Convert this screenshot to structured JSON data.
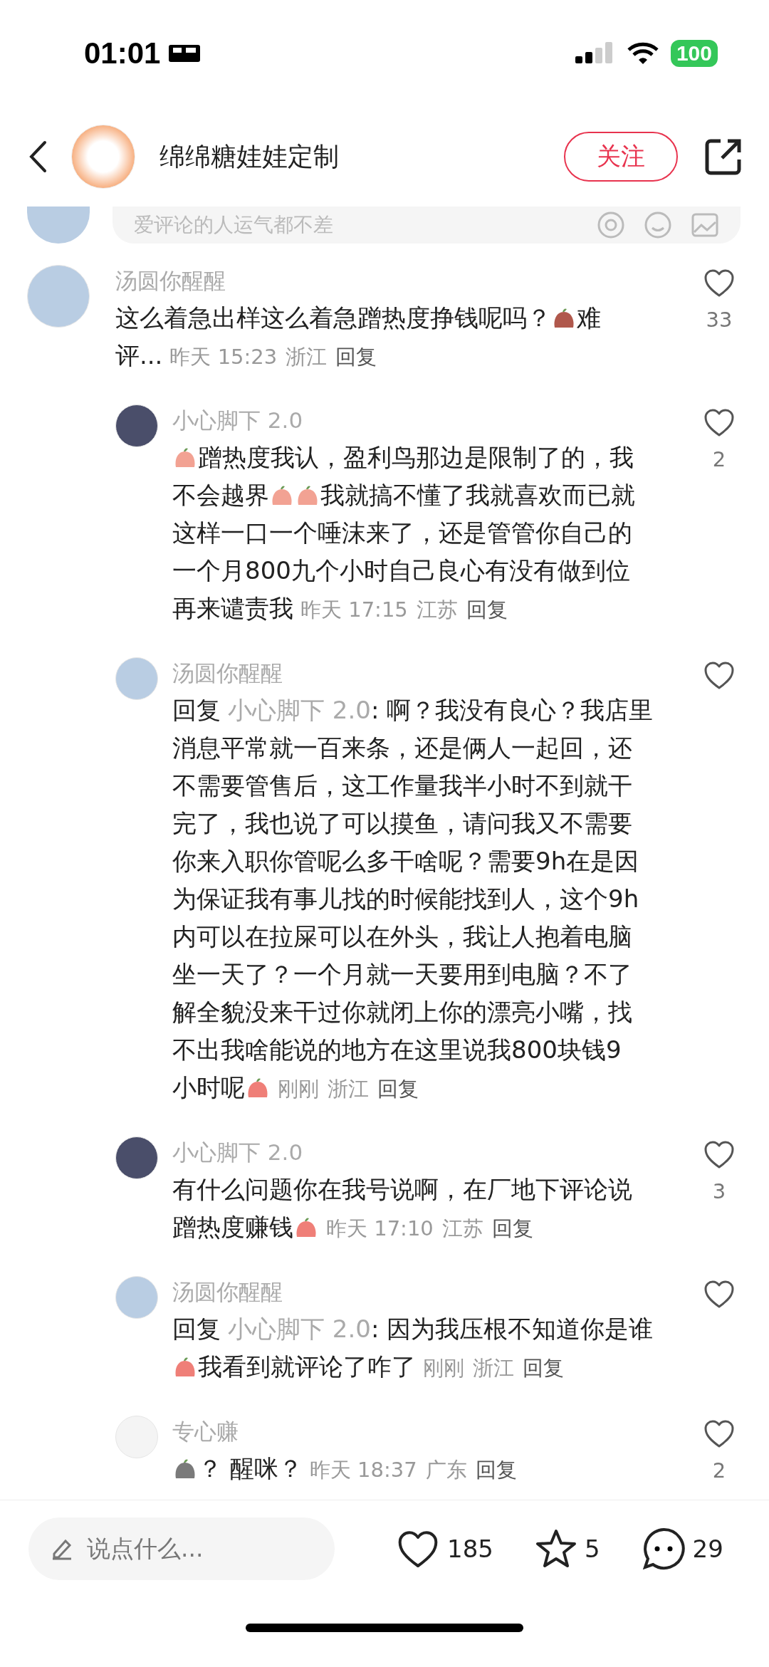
{
  "status_bar": {
    "time": "01:01",
    "battery": "100"
  },
  "header": {
    "title": "绵绵糖娃娃定制",
    "follow_button": "关注"
  },
  "comment_input": {
    "placeholder": "爱评论的人运气都不差"
  },
  "comments": [
    {
      "name": "汤圆你醒醒",
      "color": "#b9cde3",
      "lines": [
        [
          {
            "kind": "text",
            "text": "这么着急出样这么着急蹭热度挣钱呢吗？"
          },
          {
            "kind": "sticker",
            "color": "#b0584c"
          },
          {
            "kind": "text",
            "text": "难"
          }
        ],
        [
          {
            "kind": "text",
            "text": "评..."
          }
        ]
      ],
      "time": "昨天 15:23",
      "location": "浙江",
      "reply_label": "回复",
      "likes": "33",
      "replies": [
        {
          "name": "小心脚下 2.0",
          "color": "#4a4e6a",
          "lines": [
            [
              {
                "kind": "sticker",
                "color": "#f2a293"
              },
              {
                "kind": "text",
                "text": "蹭热度我认，盈利鸟那边是限制了的，我"
              }
            ],
            [
              {
                "kind": "text",
                "text": "不会越界"
              },
              {
                "kind": "sticker",
                "color": "#f2a293"
              },
              {
                "kind": "sticker",
                "color": "#f2a293"
              },
              {
                "kind": "text",
                "text": "我就搞不懂了我就喜欢而已就"
              }
            ],
            [
              {
                "kind": "text",
                "text": "这样一口一个唾沫来了，还是管管你自己的"
              }
            ],
            [
              {
                "kind": "text",
                "text": "一个月800九个小时自己良心有没有做到位"
              }
            ],
            [
              {
                "kind": "text",
                "text": "再来谴责我"
              }
            ]
          ],
          "time": "昨天 17:15",
          "location": "江苏",
          "reply_label": "回复",
          "likes": "2"
        },
        {
          "name": "汤圆你醒醒",
          "color": "#b9cde3",
          "lines": [
            [
              {
                "kind": "text",
                "text": "回复"
              },
              {
                "kind": "mention",
                "text": "小心脚下 2.0"
              },
              {
                "kind": "text",
                "text": ": 啊？我没有良心？我店里"
              }
            ],
            [
              {
                "kind": "text",
                "text": "消息平常就一百来条，还是俩人一起回，还"
              }
            ],
            [
              {
                "kind": "text",
                "text": "不需要管售后，这工作量我半小时不到就干"
              }
            ],
            [
              {
                "kind": "text",
                "text": "完了，我也说了可以摸鱼，请问我又不需要"
              }
            ],
            [
              {
                "kind": "text",
                "text": "你来入职你管呢么多干啥呢？需要9h在是因"
              }
            ],
            [
              {
                "kind": "text",
                "text": "为保证我有事儿找的时候能找到人，这个9h"
              }
            ],
            [
              {
                "kind": "text",
                "text": "内可以在拉屎可以在外头，我让人抱着电脑"
              }
            ],
            [
              {
                "kind": "text",
                "text": "坐一天了？一个月就一天要用到电脑？不了"
              }
            ],
            [
              {
                "kind": "text",
                "text": "解全貌没来干过你就闭上你的漂亮小嘴，找"
              }
            ],
            [
              {
                "kind": "text",
                "text": "不出我啥能说的地方在这里说我800块钱9"
              }
            ],
            [
              {
                "kind": "text",
                "text": "小时呢"
              },
              {
                "kind": "sticker",
                "color": "#ef7f78"
              }
            ]
          ],
          "time": "刚刚",
          "location": "浙江",
          "reply_label": "回复"
        },
        {
          "name": "小心脚下 2.0",
          "color": "#4a4e6a",
          "lines": [
            [
              {
                "kind": "text",
                "text": "有什么问题你在我号说啊，在厂地下评论说"
              }
            ],
            [
              {
                "kind": "text",
                "text": "蹭热度赚钱"
              },
              {
                "kind": "sticker",
                "color": "#ef7f78"
              }
            ]
          ],
          "time": "昨天 17:10",
          "location": "江苏",
          "reply_label": "回复",
          "likes": "3"
        },
        {
          "name": "汤圆你醒醒",
          "color": "#b9cde3",
          "lines": [
            [
              {
                "kind": "text",
                "text": "回复"
              },
              {
                "kind": "mention",
                "text": "小心脚下 2.0"
              },
              {
                "kind": "text",
                "text": ": 因为我压根不知道你是谁"
              }
            ],
            [
              {
                "kind": "sticker",
                "color": "#ef7f78"
              },
              {
                "kind": "text",
                "text": "我看到就评论了咋了"
              }
            ]
          ],
          "time": "刚刚",
          "location": "浙江",
          "reply_label": "回复"
        },
        {
          "name": "专心赚",
          "color": "#f4f4f4",
          "lines": [
            [
              {
                "kind": "sticker",
                "color": "#7a7a7a"
              },
              {
                "kind": "text",
                "text": "？ 醒咪？"
              }
            ]
          ],
          "time": "昨天 18:37",
          "location": "广东",
          "reply_label": "回复",
          "likes": "2"
        }
      ]
    }
  ],
  "bottom_bar": {
    "placeholder": "说点什么...",
    "likes": "185",
    "stars": "5",
    "comments": "29"
  }
}
